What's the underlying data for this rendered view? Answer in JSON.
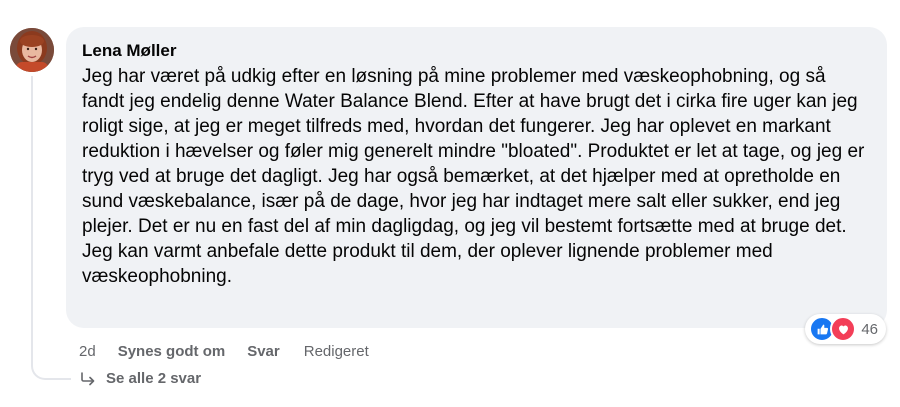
{
  "comment": {
    "author": "Lena Møller",
    "text": "Jeg har været på udkig efter en løsning på mine problemer med væskeophobning, og så fandt jeg endelig denne Water Balance Blend. Efter at have brugt det i cirka fire uger kan jeg roligt sige, at jeg er meget tilfreds med, hvordan det fungerer. Jeg har oplevet en markant reduktion i hævelser og føler mig generelt mindre \"bloated\". Produktet er let at tage, og jeg er tryg ved at bruge det dagligt. Jeg har også bemærket, at det hjælper med at opretholde en sund væskebalance, især på de dage, hvor jeg har indtaget mere salt eller sukker, end jeg plejer. Det er nu en fast del af min dagligdag, og jeg vil bestemt fortsætte med at bruge det. Jeg kan varmt anbefale dette produkt til dem, der oplever lignende problemer med væskeophobning.",
    "time": "2d",
    "like_label": "Synes godt om",
    "reply_label": "Svar",
    "edited_label": "Redigeret"
  },
  "reactions": {
    "icons": [
      "like-icon",
      "love-icon"
    ],
    "count": "46",
    "colors": {
      "like": "#1877f2",
      "love": "#f33e58"
    }
  },
  "replies": {
    "label": "Se alle 2 svar",
    "icon": "reply-arrow-icon"
  }
}
